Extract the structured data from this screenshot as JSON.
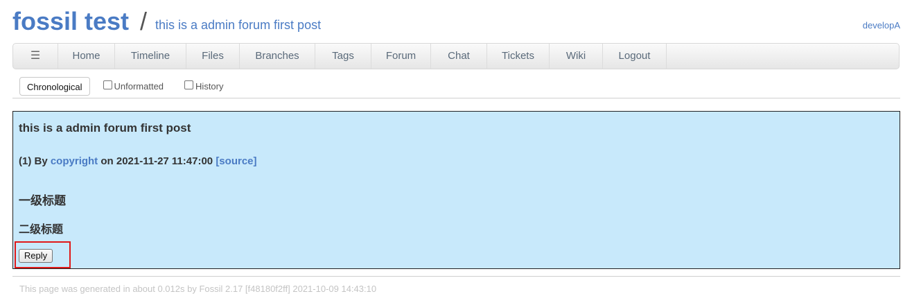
{
  "header": {
    "project": "fossil test",
    "separator": "/",
    "page_title": "this is a admin forum first post",
    "login": "developA"
  },
  "mainmenu": {
    "hamburger": "☰",
    "items": [
      "Home",
      "Timeline",
      "Files",
      "Branches",
      "Tags",
      "Forum",
      "Chat",
      "Tickets",
      "Wiki",
      "Logout"
    ]
  },
  "submenu": {
    "chronological": "Chronological",
    "unformatted": "Unformatted",
    "history": "History"
  },
  "post": {
    "title": "this is a admin forum first post",
    "meta_prefix": "(1) By ",
    "author": "copyright",
    "meta_on": " on 2021-11-27 11:47:00 ",
    "source": "[source]",
    "heading1": "一级标题",
    "heading2": "二级标题",
    "reply": "Reply"
  },
  "footer": {
    "text": "This page was generated in about 0.012s by Fossil 2.17 [f48180f2ff] 2021-10-09 14:43:10"
  },
  "colors": {
    "accent": "#4a7bc4",
    "post_bg": "#c8e9fb",
    "highlight": "#e01818"
  }
}
